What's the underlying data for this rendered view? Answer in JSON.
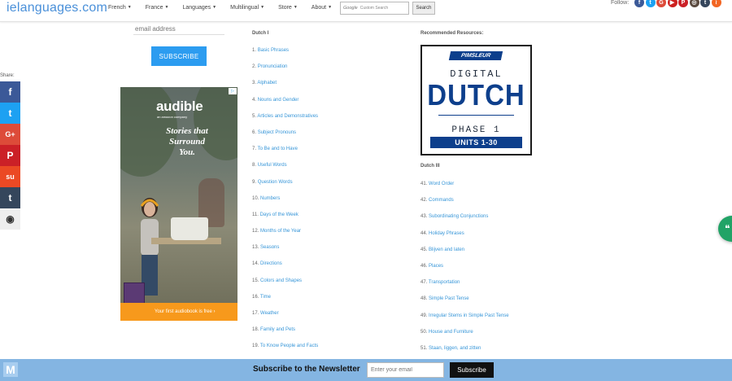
{
  "header": {
    "logo": "ielanguages.com",
    "nav": [
      "French",
      "France",
      "Languages",
      "Multilingual",
      "Store",
      "About"
    ],
    "search_placeholder": "Custom Search",
    "search_brand": "Google",
    "search_button": "Search",
    "follow_label": "Follow:",
    "socials": [
      {
        "icon": "facebook-icon",
        "color": "#3b5998",
        "glyph": "f"
      },
      {
        "icon": "twitter-icon",
        "color": "#1da1f2",
        "glyph": "t"
      },
      {
        "icon": "googleplus-icon",
        "color": "#dd4b39",
        "glyph": "G"
      },
      {
        "icon": "youtube-icon",
        "color": "#cd201f",
        "glyph": "▶"
      },
      {
        "icon": "pinterest-icon",
        "color": "#cb2027",
        "glyph": "P"
      },
      {
        "icon": "instagram-icon",
        "color": "#5b4a3f",
        "glyph": "◎"
      },
      {
        "icon": "tumblr-icon",
        "color": "#35465c",
        "glyph": "t"
      },
      {
        "icon": "rss-icon",
        "color": "#f26522",
        "glyph": "≀"
      }
    ]
  },
  "share": {
    "label": "Share:",
    "buttons": [
      {
        "icon": "facebook-icon",
        "color": "#3b5998",
        "glyph": "f"
      },
      {
        "icon": "twitter-icon",
        "color": "#1da1f2",
        "glyph": "t"
      },
      {
        "icon": "googleplus-icon",
        "color": "#dd4b39",
        "glyph": "G+"
      },
      {
        "icon": "pinterest-icon",
        "color": "#cb2027",
        "glyph": "P"
      },
      {
        "icon": "stumbleupon-icon",
        "color": "#eb4924",
        "glyph": "su"
      },
      {
        "icon": "tumblr-icon",
        "color": "#35465c",
        "glyph": "t"
      },
      {
        "icon": "reddit-icon",
        "color": "#eeeeee",
        "glyph": "◉"
      }
    ]
  },
  "signup": {
    "email_placeholder": "email address",
    "button": "SUBSCRIBE"
  },
  "ad": {
    "brand": "audible",
    "brand_sub": "an amazon company",
    "tagline": "Stories that Surround You.",
    "cta": "Your first audiobook is free ›"
  },
  "dutch1": {
    "title": "Dutch I",
    "items": [
      {
        "num": "1.",
        "label": "Basic Phrases"
      },
      {
        "num": "2.",
        "label": "Pronunciation"
      },
      {
        "num": "3.",
        "label": "Alphabet"
      },
      {
        "num": "4.",
        "label": "Nouns and Gender"
      },
      {
        "num": "5.",
        "label": "Articles and Demonstratives"
      },
      {
        "num": "6.",
        "label": "Subject Pronouns"
      },
      {
        "num": "7.",
        "label": "To Be and to Have"
      },
      {
        "num": "8.",
        "label": "Useful Words"
      },
      {
        "num": "9.",
        "label": "Question Words"
      },
      {
        "num": "10.",
        "label": "Numbers"
      },
      {
        "num": "11.",
        "label": "Days of the Week"
      },
      {
        "num": "12.",
        "label": "Months of the Year"
      },
      {
        "num": "13.",
        "label": "Seasons"
      },
      {
        "num": "14.",
        "label": "Directions"
      },
      {
        "num": "15.",
        "label": "Colors and Shapes"
      },
      {
        "num": "16.",
        "label": "Time"
      },
      {
        "num": "17.",
        "label": "Weather"
      },
      {
        "num": "18.",
        "label": "Family and Pets"
      },
      {
        "num": "19.",
        "label": "To Know People and Facts"
      }
    ]
  },
  "resources": {
    "title": "Recommended Resources:",
    "product": {
      "brand": "PIMSLEUR",
      "line1": "DIGITAL",
      "line2": "DUTCH",
      "line3": "PHASE 1",
      "line4": "UNITS 1-30"
    }
  },
  "dutch3": {
    "title": "Dutch III",
    "items": [
      {
        "num": "41.",
        "label": "Word Order"
      },
      {
        "num": "42.",
        "label": "Commands"
      },
      {
        "num": "43.",
        "label": "Subordinating Conjunctions"
      },
      {
        "num": "44.",
        "label": "Holiday Phrases"
      },
      {
        "num": "45.",
        "label": "Blijven and laten"
      },
      {
        "num": "46.",
        "label": "Places"
      },
      {
        "num": "47.",
        "label": "Transportation"
      },
      {
        "num": "48.",
        "label": "Simple Past Tense"
      },
      {
        "num": "49.",
        "label": "Irregular Stems in Simple Past Tense"
      },
      {
        "num": "50.",
        "label": "House and Furniture"
      },
      {
        "num": "51.",
        "label": "Staan, liggen, and zitten"
      }
    ]
  },
  "newsletter": {
    "label": "Subscribe to the Newsletter",
    "placeholder": "Enter your email",
    "button": "Subscribe",
    "badge": "M"
  }
}
